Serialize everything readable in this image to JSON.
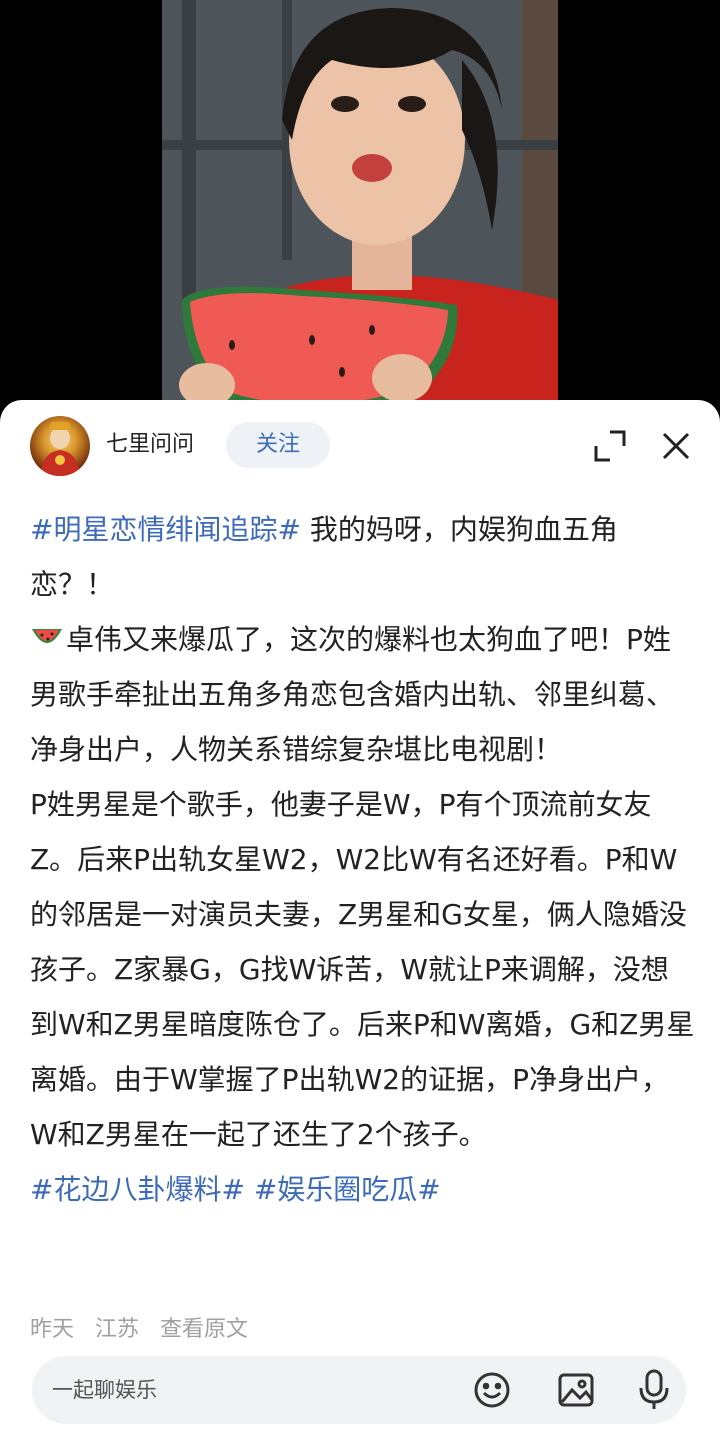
{
  "post": {
    "author": "七里问问",
    "follow_label": "关注",
    "hashtag_top": "#明星恋情绯闻追踪#",
    "line1_text": " 我的妈呀，内娱狗血五角恋？！",
    "line2_text": "卓伟又来爆瓜了，这次的爆料也太狗血了吧！P姓男歌手牵扯出五角多角恋包含婚内出轨、邻里纠葛、净身出户，人物关系错综复杂堪比电视剧！",
    "line3_text": "P姓男星是个歌手，他妻子是W，P有个顶流前女友Z。后来P出轨女星W2，W2比W有名还好看。P和W的邻居是一对演员夫妻，Z男星和G女星，俩人隐婚没孩子。Z家暴G，G找W诉苦，W就让P来调解，没想到W和Z男星暗度陈仓了。后来P和W离婚，G和Z男星离婚。由于W掌握了P出轨W2的证据，P净身出户，W和Z男星在一起了还生了2个孩子。",
    "hashtag_bottom_1": "#花边八卦爆料#",
    "hashtag_bottom_2": "#娱乐圈吃瓜#",
    "meta_time": "昨天",
    "meta_location": "江苏",
    "meta_view_original": "查看原文"
  },
  "comment_bar": {
    "placeholder": "一起聊娱乐"
  },
  "icons": [
    "expand-icon",
    "close-icon",
    "watermelon-emoji-icon",
    "emoji-icon",
    "image-icon",
    "microphone-icon"
  ],
  "colors": {
    "hashtag": "#3d6bb8",
    "follow_text": "#3e6fb6",
    "follow_bg": "#eef1f6",
    "meta": "#a0a0a0"
  }
}
